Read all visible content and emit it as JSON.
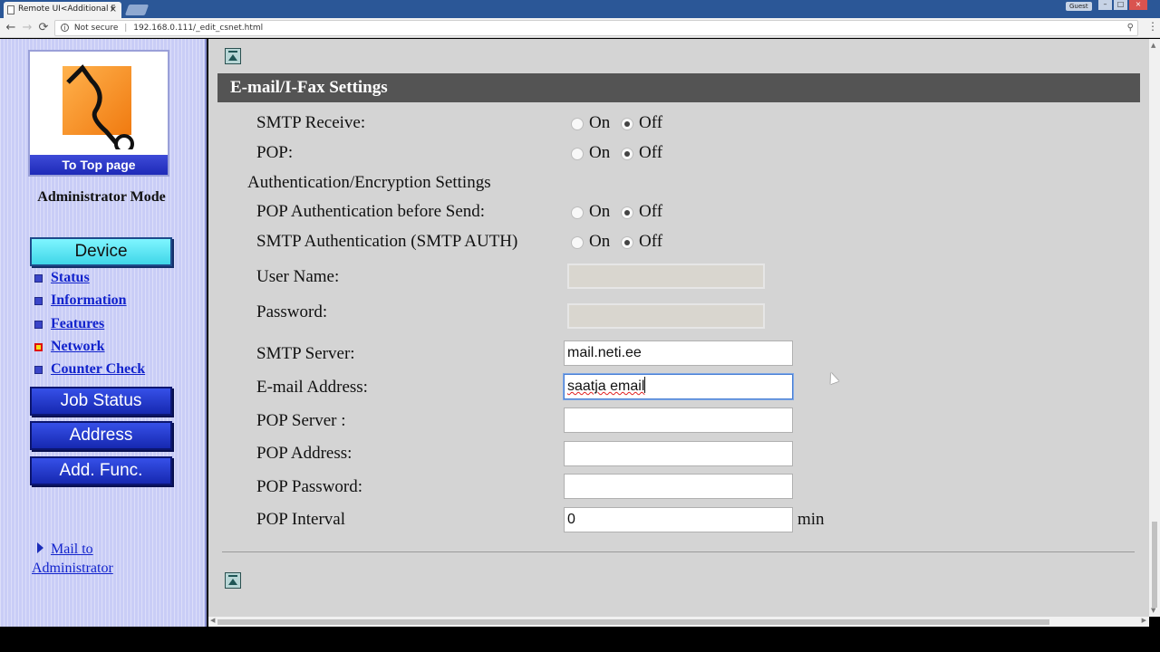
{
  "browser": {
    "tab_title": "Remote UI<Additional F",
    "tab_close": "×",
    "guest_label": "Guest",
    "win_min": "–",
    "win_max": "□",
    "win_close": "×",
    "back": "←",
    "forward": "→",
    "reload": "⟳",
    "security_label": "Not secure",
    "url": "192.168.0.111/_edit_csnet.html",
    "zoom_icon": "⚲",
    "menu_icon": "⋮"
  },
  "sidebar": {
    "top_page_label": "To Top page",
    "admin_mode": "Administrator Mode",
    "device_button": "Device",
    "nav": [
      {
        "label": "Status",
        "active": false
      },
      {
        "label": "Information",
        "active": false
      },
      {
        "label": "Features",
        "active": false
      },
      {
        "label": "Network",
        "active": true
      },
      {
        "label": "Counter Check",
        "active": false
      }
    ],
    "job_status_button": "Job Status",
    "address_button": "Address",
    "add_func_button": "Add. Func.",
    "mail_admin_line1": "Mail to",
    "mail_admin_line2": "Administrator"
  },
  "main": {
    "section_title": "E-mail/I-Fax Settings",
    "on_label": "On",
    "off_label": "Off",
    "smtp_receive": {
      "label": "SMTP Receive:",
      "value": "Off"
    },
    "pop": {
      "label": "POP:",
      "value": "Off"
    },
    "auth_heading": "Authentication/Encryption Settings",
    "pop_auth_before_send": {
      "label": "POP Authentication before Send:",
      "value": "Off"
    },
    "smtp_auth": {
      "label": "SMTP Authentication (SMTP AUTH)",
      "value": "Off"
    },
    "user_name": {
      "label": "User Name:",
      "value": ""
    },
    "password": {
      "label": "Password:",
      "value": ""
    },
    "smtp_server": {
      "label": "SMTP Server:",
      "value": "mail.neti.ee"
    },
    "email_address": {
      "label": "E-mail Address:",
      "value": "saatja email"
    },
    "pop_server": {
      "label": "POP Server :",
      "value": ""
    },
    "pop_address": {
      "label": "POP Address:",
      "value": ""
    },
    "pop_password": {
      "label": "POP Password:",
      "value": ""
    },
    "pop_interval": {
      "label": "POP Interval",
      "value": "0",
      "unit": "min"
    }
  },
  "icons": {
    "page_up": "page-up-icon",
    "logo": "top-page-logo"
  }
}
